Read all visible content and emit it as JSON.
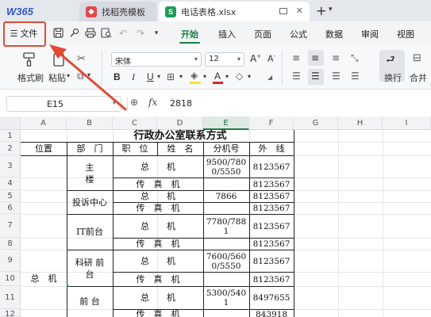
{
  "tabs": {
    "brand": "W365",
    "tab2": "找稻壳模板",
    "tab3": "电话表格.xlsx",
    "tab2_icon": "docer-icon",
    "tab3_icon": "sheet-icon",
    "tab3_icon_letter": "S"
  },
  "menu": {
    "file": "文件",
    "items": [
      "开始",
      "插入",
      "页面",
      "公式",
      "数据",
      "审阅",
      "视图"
    ],
    "active": "开始"
  },
  "ribbon": {
    "format_painter": "格式刷",
    "paste": "粘贴",
    "font_name": "宋体",
    "font_size": "12",
    "wrap": "换行",
    "merge": "合并"
  },
  "formula_bar": {
    "cell_ref": "E15",
    "fx": "fx",
    "value": "2818"
  },
  "columns": [
    "A",
    "B",
    "C",
    "D",
    "E",
    "F",
    "G",
    "H",
    "I"
  ],
  "rows": [
    "1",
    "2",
    "3",
    "4",
    "5",
    "6",
    "7",
    "8",
    "9",
    "10",
    "11",
    "12"
  ],
  "sheet": {
    "title": "行政办公室联系方式",
    "headers": {
      "location": "位置",
      "dept": "部　门",
      "position": "职　位",
      "name": "姓　名",
      "ext": "分机号",
      "line": "外　线"
    },
    "location_value": "总　机",
    "depts": {
      "main_building": "主\n楼",
      "complaint": "投诉中心",
      "it": "IT前台",
      "rnd": "科研 前\n台",
      "front": "前 台"
    },
    "positions": {
      "operator": "总　　机",
      "fax": "传　真　机"
    },
    "ext": {
      "r3": "9500/780\n0/5550",
      "r5": "7866",
      "r7": "7780/788\n1",
      "r9": "7600/560\n0/5550",
      "r11": "5300/540\n1"
    },
    "line": {
      "r3": "8123567",
      "r4": "8123567",
      "r5": "8123567",
      "r6": "8123567",
      "r7": "8123567",
      "r8": "8123567",
      "r9": "8123567",
      "r10": "8123567",
      "r11": "8497655",
      "r12": "843918"
    }
  },
  "colors": {
    "accent": "#1a7f46",
    "annotation": "#e34a33",
    "brand": "#3557c9"
  }
}
